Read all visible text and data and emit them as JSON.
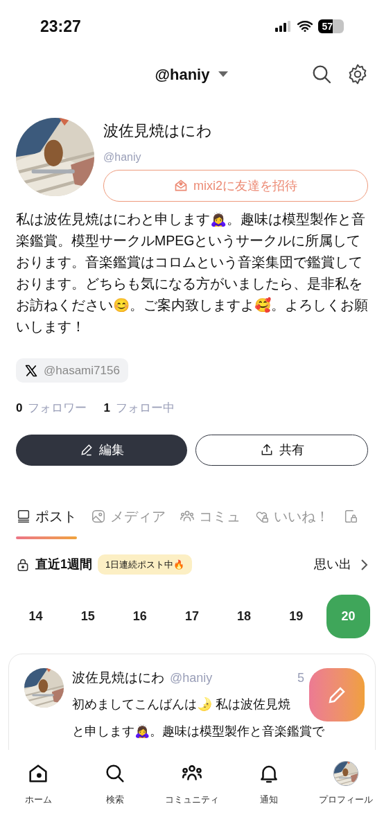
{
  "status_bar": {
    "time": "23:27",
    "battery": "57"
  },
  "header": {
    "account": "@haniy"
  },
  "profile": {
    "name": "波佐見焼はにわ",
    "handle": "@haniy",
    "invite_button": "mixi2に友達を招待",
    "bio": "私は波佐見焼はにわと申します🙇‍♀️。趣味は模型製作と音楽鑑賞。模型サークルMPEGというサークルに所属しております。音楽鑑賞はコロムという音楽集団で鑑賞しております。どちらも気になる方がいましたら、是非私をお訪ねください😊。ご案内致しますよ🥰。よろしくお願いします！",
    "x_link": "@hasami7156",
    "followers": {
      "count": "0",
      "label": "フォロワー"
    },
    "following": {
      "count": "1",
      "label": "フォロー中"
    },
    "edit_button": "編集",
    "share_button": "共有"
  },
  "tabs": [
    {
      "label": "ポスト",
      "selected": true
    },
    {
      "label": "メディア",
      "selected": false
    },
    {
      "label": "コミュ",
      "selected": false
    },
    {
      "label": "いいね！",
      "selected": false
    }
  ],
  "week": {
    "title": "直近1週間",
    "streak_badge": "1日連続ポスト中🔥",
    "memories_link": "思い出",
    "days": [
      {
        "label": "14",
        "selected": false
      },
      {
        "label": "15",
        "selected": false
      },
      {
        "label": "16",
        "selected": false
      },
      {
        "label": "17",
        "selected": false
      },
      {
        "label": "18",
        "selected": false
      },
      {
        "label": "19",
        "selected": false
      },
      {
        "label": "20",
        "selected": true
      }
    ]
  },
  "post": {
    "name": "波佐見焼はにわ",
    "handle": "@haniy",
    "time": "5",
    "lines": [
      "初めましてこんばんは🌛 私は波佐見焼",
      "と申します🙇‍♀️。趣味は模型製作と音楽鑑賞で"
    ]
  },
  "bottom_nav": [
    {
      "label": "ホーム"
    },
    {
      "label": "検索"
    },
    {
      "label": "コミュニティ"
    },
    {
      "label": "通知"
    },
    {
      "label": "プロフィール"
    }
  ]
}
